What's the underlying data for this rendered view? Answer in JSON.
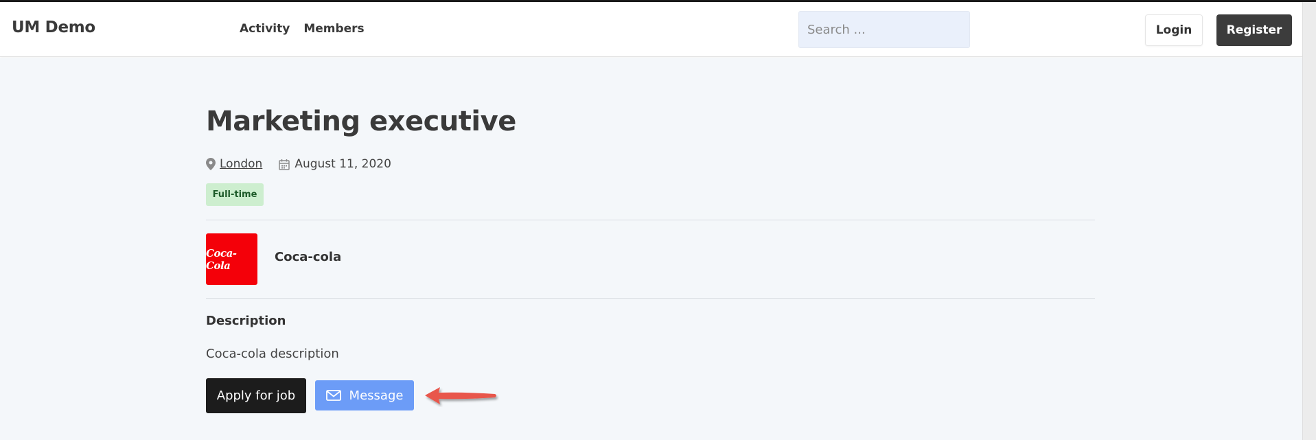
{
  "header": {
    "brand": "UM Demo",
    "nav": [
      "Activity",
      "Members"
    ],
    "search_placeholder": "Search ...",
    "login_label": "Login",
    "register_label": "Register"
  },
  "job": {
    "title": "Marketing executive",
    "location": "London",
    "date": "August 11, 2020",
    "type_badge": "Full-time",
    "company": "Coca-cola",
    "company_logo_text": "Coca-Cola",
    "description_heading": "Description",
    "description": "Coca-cola description"
  },
  "actions": {
    "apply_label": "Apply for job",
    "message_label": "Message"
  },
  "colors": {
    "brand_dark": "#3c3c3c",
    "message_blue": "#6c9cf7",
    "badge_green": "#cdeecf",
    "coke_red": "#f40009",
    "annotation_arrow": "#e8574c"
  }
}
